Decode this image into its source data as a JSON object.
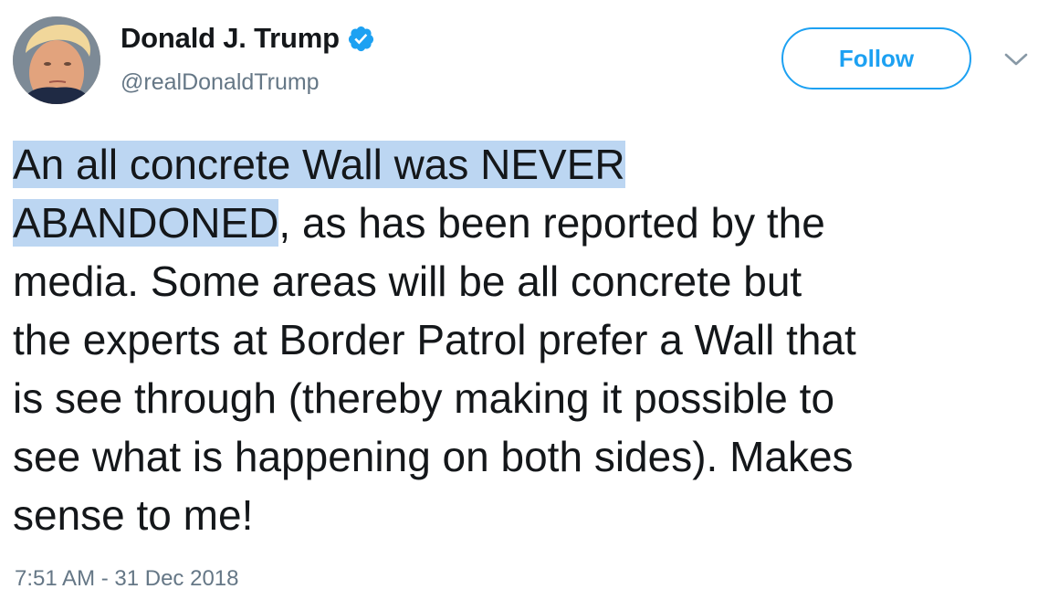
{
  "author": {
    "display_name": "Donald J. Trump",
    "handle": "@realDonaldTrump",
    "verified": true,
    "avatar_icon": "profile-photo"
  },
  "actions": {
    "follow_label": "Follow",
    "menu_icon": "chevron-down-icon"
  },
  "tweet": {
    "text_highlighted": "An all concrete Wall was NEVER\nABANDONED",
    "text_rest": ", as has been reported by the\nmedia. Some areas will be all concrete but\nthe experts at Border Patrol prefer a Wall that\nis see through (thereby making it possible to\nsee what is happening on both sides). Makes\nsense to me!",
    "timestamp": "7:51 AM - 31 Dec 2018"
  },
  "colors": {
    "accent": "#1da1f2",
    "text": "#14171a",
    "secondary_text": "#657786",
    "selection_highlight": "#bcd6f2"
  }
}
